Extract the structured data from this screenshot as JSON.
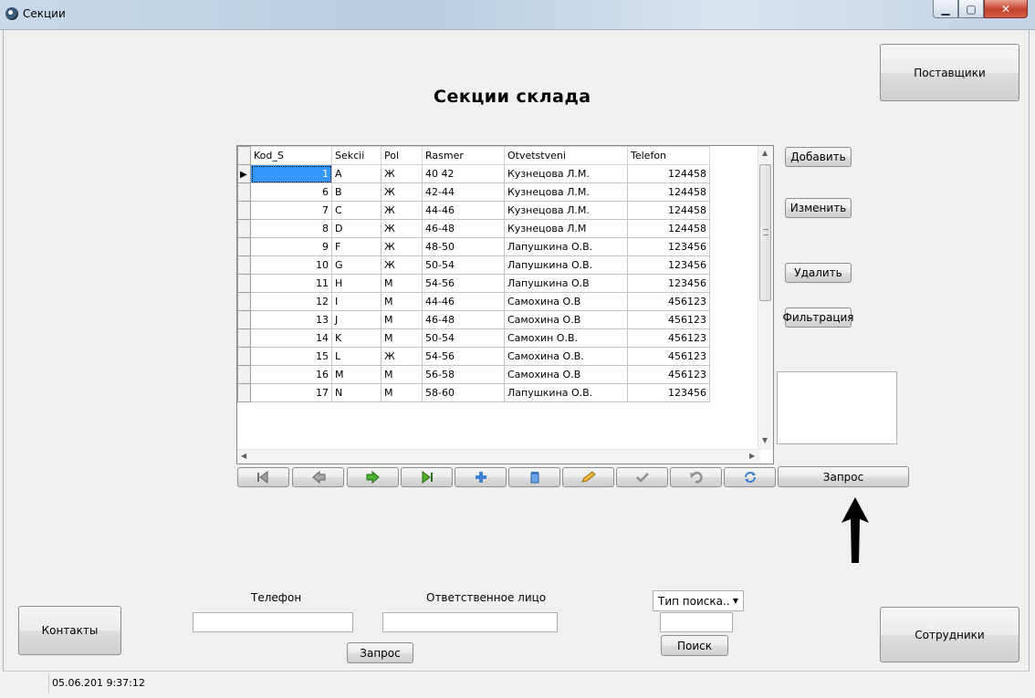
{
  "window": {
    "title": "Секции"
  },
  "heading": "Секции склада",
  "buttons": {
    "suppliers": "Поставщики",
    "contacts": "Контакты",
    "employees": "Сотрудники",
    "add": "Добавить",
    "edit": "Изменить",
    "delete": "Удалить",
    "filter": "Фильтрация",
    "query_main": "Запрос",
    "query_bottom": "Запрос",
    "search": "Поиск"
  },
  "grid": {
    "columns": [
      "Kod_S",
      "Sekcii",
      "Pol",
      "Rasmer",
      "Otvetstveni",
      "Telefon"
    ],
    "rows": [
      [
        "1",
        "A",
        "Ж",
        "40 42",
        "Кузнецова Л.М.",
        "124458"
      ],
      [
        "6",
        "B",
        "Ж",
        "42-44",
        "Кузнецова Л.М.",
        "124458"
      ],
      [
        "7",
        "C",
        "Ж",
        "44-46",
        "Кузнецова Л.М.",
        "124458"
      ],
      [
        "8",
        "D",
        "Ж",
        "46-48",
        "Кузнецова Л.М",
        "124458"
      ],
      [
        "9",
        "F",
        "Ж",
        "48-50",
        "Лапушкина О.В.",
        "123456"
      ],
      [
        "10",
        "G",
        "Ж",
        "50-54",
        "Лапушкина О.В.",
        "123456"
      ],
      [
        "11",
        "H",
        "М",
        "54-56",
        "Лапушкина О.В",
        "123456"
      ],
      [
        "12",
        "I",
        "М",
        "44-46",
        "Самохина О.В",
        "456123"
      ],
      [
        "13",
        "J",
        "М",
        "46-48",
        "Самохина О.В",
        "456123"
      ],
      [
        "14",
        "K",
        "М",
        "50-54",
        "Самохин О.В.",
        "456123"
      ],
      [
        "15",
        "L",
        "Ж",
        "54-56",
        "Самохина О.В.",
        "456123"
      ],
      [
        "16",
        "M",
        "М",
        "56-58",
        "Самохина О.В",
        "456123"
      ],
      [
        "17",
        "N",
        "М",
        "58-60",
        "Лапушкина О.В.",
        "123456"
      ]
    ]
  },
  "search": {
    "phone_label": "Телефон",
    "phone_value": "",
    "person_label": "Ответственное лицо",
    "person_value": "",
    "type_selected": "Тип поиска..",
    "search_value": ""
  },
  "status": {
    "datetime": "05.06.201 9:37:12"
  },
  "icons": {
    "nav": [
      "first-record-icon",
      "prior-record-icon",
      "next-record-icon",
      "last-record-icon",
      "insert-record-icon",
      "delete-record-icon",
      "edit-record-icon",
      "post-record-icon",
      "cancel-edit-icon",
      "refresh-data-icon"
    ]
  }
}
